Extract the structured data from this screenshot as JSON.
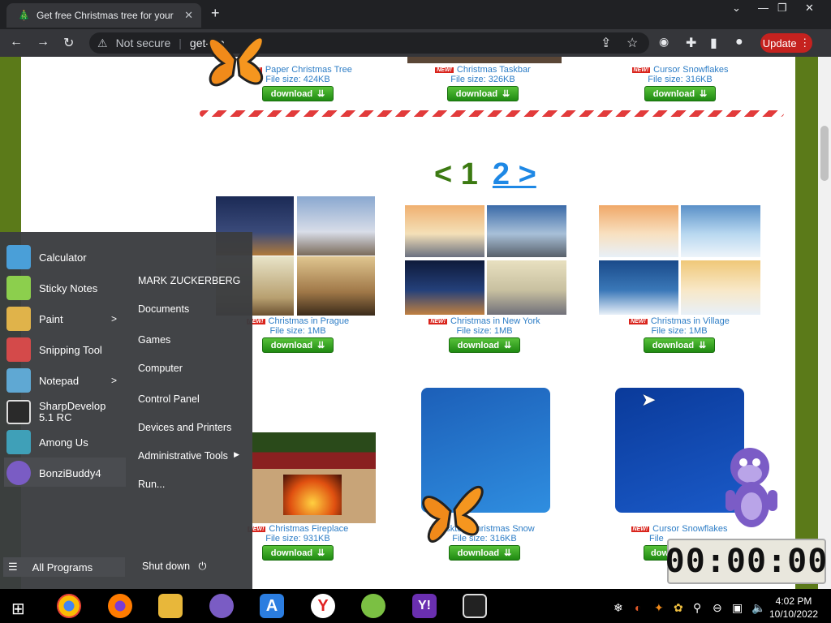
{
  "browser": {
    "tab_title": "Get free Christmas tree for your d",
    "address_prefix": "Not secure",
    "address_url": "get-xm",
    "update_label": "Update"
  },
  "page": {
    "top_row": [
      {
        "title": "Paper Christmas Tree",
        "size": "File size: 424KB",
        "download": "download"
      },
      {
        "title": "Christmas Taskbar",
        "size": "File size: 326KB",
        "download": "download"
      },
      {
        "title": "Cursor Snowflakes",
        "size": "File size: 316KB",
        "download": "download"
      }
    ],
    "pager": {
      "current": "< 1",
      "next": "2 >"
    },
    "middle_row": [
      {
        "title": "Christmas in Prague",
        "size": "File size: 1MB",
        "download": "download"
      },
      {
        "title": "Christmas in New York",
        "size": "File size: 1MB",
        "download": "download"
      },
      {
        "title": "Christmas in Village",
        "size": "File size: 1MB",
        "download": "download"
      }
    ],
    "bottom_row": [
      {
        "title": "Christmas Fireplace",
        "size": "File size: 931KB",
        "download": "download"
      },
      {
        "title": "Desktop Christmas Snow",
        "size": "File size: 316KB",
        "download": "download"
      },
      {
        "title": "Cursor Snowflakes",
        "size": "File",
        "download": "dow"
      }
    ],
    "new_badge": "NEW!"
  },
  "start_menu": {
    "programs": [
      {
        "label": "Calculator",
        "icon": "calculator-icon",
        "color": "#4a9fd8"
      },
      {
        "label": "Sticky Notes",
        "icon": "sticky-notes-icon",
        "color": "#8ccf4d"
      },
      {
        "label": "Paint",
        "icon": "paint-icon",
        "color": "#e0b34a",
        "arrow": ">"
      },
      {
        "label": "Snipping Tool",
        "icon": "scissors-icon",
        "color": "#d44a4a"
      },
      {
        "label": "Notepad",
        "icon": "notepad-icon",
        "color": "#5fa8d3",
        "arrow": ">"
      },
      {
        "label": "SharpDevelop\n5.1 RC",
        "icon": "sharpdevelop-icon",
        "color": "#2a2a2a"
      },
      {
        "label": "Among Us",
        "icon": "among-us-icon",
        "color": "#3fa0b8"
      },
      {
        "label": "BonziBuddy4",
        "icon": "bonzibuddy-icon",
        "color": "#7a5cc4"
      }
    ],
    "places": [
      {
        "label": "MARK ZUCKERBERG"
      },
      {
        "label": "Documents"
      },
      {
        "label": "Games"
      },
      {
        "label": "Computer"
      },
      {
        "label": "Control Panel"
      },
      {
        "label": "Devices and Printers"
      },
      {
        "label": "Administrative Tools",
        "arrow": "▶"
      },
      {
        "label": "Run..."
      }
    ],
    "all_programs": "All Programs",
    "shut_down": "Shut down"
  },
  "timer": "00:00:00",
  "taskbar": {
    "time": "4:02 PM",
    "date": "10/10/2022"
  }
}
